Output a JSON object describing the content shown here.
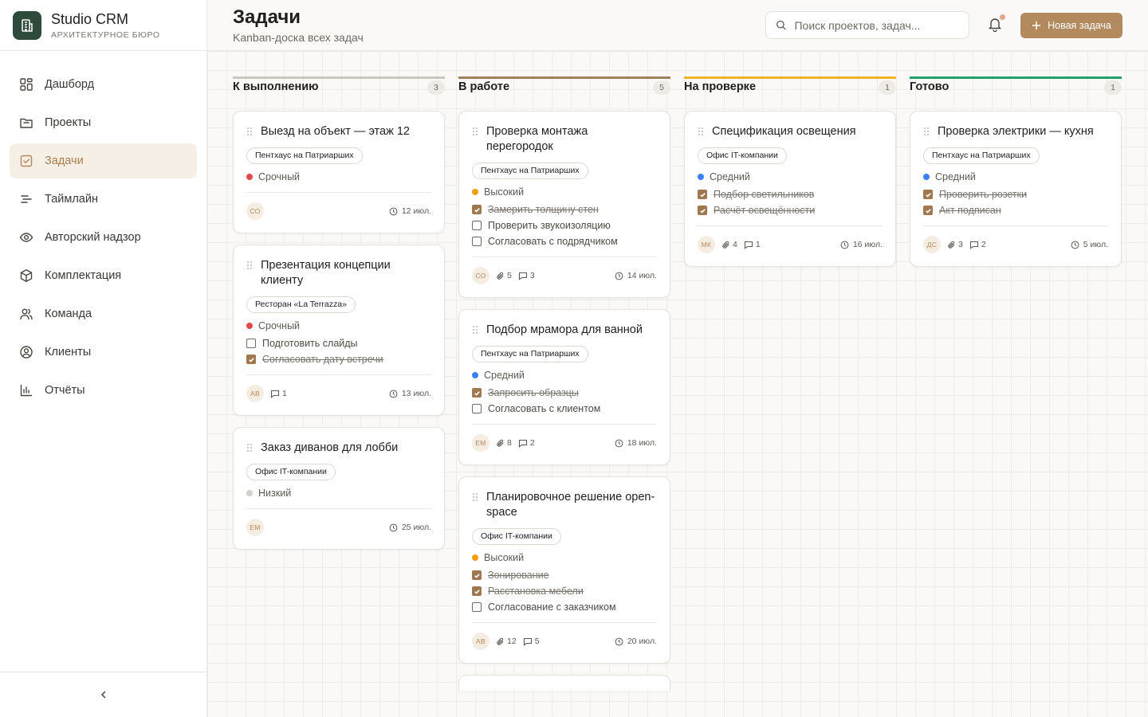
{
  "brand": {
    "title": "Studio CRM",
    "subtitle": "АРХИТЕКТУРНОЕ БЮРО"
  },
  "nav": [
    {
      "label": "Дашборд",
      "icon": "dashboard-icon"
    },
    {
      "label": "Проекты",
      "icon": "folder-icon"
    },
    {
      "label": "Задачи",
      "icon": "tasks-icon",
      "active": true
    },
    {
      "label": "Таймлайн",
      "icon": "timeline-icon"
    },
    {
      "label": "Авторский надзор",
      "icon": "eye-icon"
    },
    {
      "label": "Комплектация",
      "icon": "box-icon"
    },
    {
      "label": "Команда",
      "icon": "team-icon"
    },
    {
      "label": "Клиенты",
      "icon": "client-icon"
    },
    {
      "label": "Отчёты",
      "icon": "chart-icon"
    }
  ],
  "header": {
    "title": "Задачи",
    "subtitle": "Kanban-доска всех задач",
    "search_placeholder": "Поиск проектов, задач...",
    "new_task": "Новая задача"
  },
  "colors": {
    "accent": "#b38a5e",
    "urgent": "#e5484d",
    "high": "#f59e0b",
    "medium": "#3b82f6",
    "low": "#c9c5bf",
    "review": "#f0b429",
    "done": "#22a06b",
    "in_progress": "#a0805c"
  },
  "columns": [
    {
      "title": "К выполнению",
      "count": "3",
      "color": "#c9c5bf",
      "cards": [
        {
          "title": "Выезд на объект — этаж 12",
          "tag": "Пентхаус на Патриарших",
          "priority": "Срочный",
          "priority_color": "#e5484d",
          "checks": [],
          "avatar": "СО",
          "files": "",
          "comments": "",
          "due": "12 июл."
        },
        {
          "title": "Презентация концепции клиенту",
          "tag": "Ресторан «La Terrazza»",
          "priority": "Срочный",
          "priority_color": "#e5484d",
          "checks": [
            {
              "text": "Подготовить слайды",
              "done": false
            },
            {
              "text": "Согласовать дату встречи",
              "done": true
            }
          ],
          "avatar": "АВ",
          "files": "",
          "comments": "1",
          "due": "13 июл."
        },
        {
          "title": "Заказ диванов для лобби",
          "tag": "Офис IT-компании",
          "priority": "Низкий",
          "priority_color": "#d4d0ca",
          "checks": [],
          "avatar": "ЕМ",
          "files": "",
          "comments": "",
          "due": "25 июл."
        }
      ]
    },
    {
      "title": "В работе",
      "count": "5",
      "color": "#a0805c",
      "cards": [
        {
          "title": "Проверка монтажа перегородок",
          "tag": "Пентхаус на Патриарших",
          "priority": "Высокий",
          "priority_color": "#f59e0b",
          "checks": [
            {
              "text": "Замерить толщину стен",
              "done": true
            },
            {
              "text": "Проверить звукоизоляцию",
              "done": false
            },
            {
              "text": "Согласовать с подрядчиком",
              "done": false
            }
          ],
          "avatar": "СО",
          "files": "5",
          "comments": "3",
          "due": "14 июл."
        },
        {
          "title": "Подбор мрамора для ванной",
          "tag": "Пентхаус на Патриарших",
          "priority": "Средний",
          "priority_color": "#3b82f6",
          "checks": [
            {
              "text": "Запросить образцы",
              "done": true
            },
            {
              "text": "Согласовать с клиентом",
              "done": false
            }
          ],
          "avatar": "ЕМ",
          "files": "8",
          "comments": "2",
          "due": "18 июл."
        },
        {
          "title": "Планировочное решение open-space",
          "tag": "Офис IT-компании",
          "priority": "Высокий",
          "priority_color": "#f59e0b",
          "checks": [
            {
              "text": "Зонирование",
              "done": true
            },
            {
              "text": "Расстановка мебели",
              "done": true
            },
            {
              "text": "Согласование с заказчиком",
              "done": false
            }
          ],
          "avatar": "АВ",
          "files": "12",
          "comments": "5",
          "due": "20 июл."
        }
      ]
    },
    {
      "title": "На проверке",
      "count": "1",
      "color": "#f0b429",
      "cards": [
        {
          "title": "Спецификация освещения",
          "tag": "Офис IT-компании",
          "priority": "Средний",
          "priority_color": "#3b82f6",
          "checks": [
            {
              "text": "Подбор светильников",
              "done": true
            },
            {
              "text": "Расчёт освещённости",
              "done": true
            }
          ],
          "avatar": "МК",
          "files": "4",
          "comments": "1",
          "due": "16 июл."
        }
      ]
    },
    {
      "title": "Готово",
      "count": "1",
      "color": "#22a06b",
      "cards": [
        {
          "title": "Проверка электрики — кухня",
          "tag": "Пентхаус на Патриарших",
          "priority": "Средний",
          "priority_color": "#3b82f6",
          "checks": [
            {
              "text": "Проверить розетки",
              "done": true
            },
            {
              "text": "Акт подписан",
              "done": true
            }
          ],
          "avatar": "ДС",
          "files": "3",
          "comments": "2",
          "due": "5 июл."
        }
      ]
    }
  ]
}
